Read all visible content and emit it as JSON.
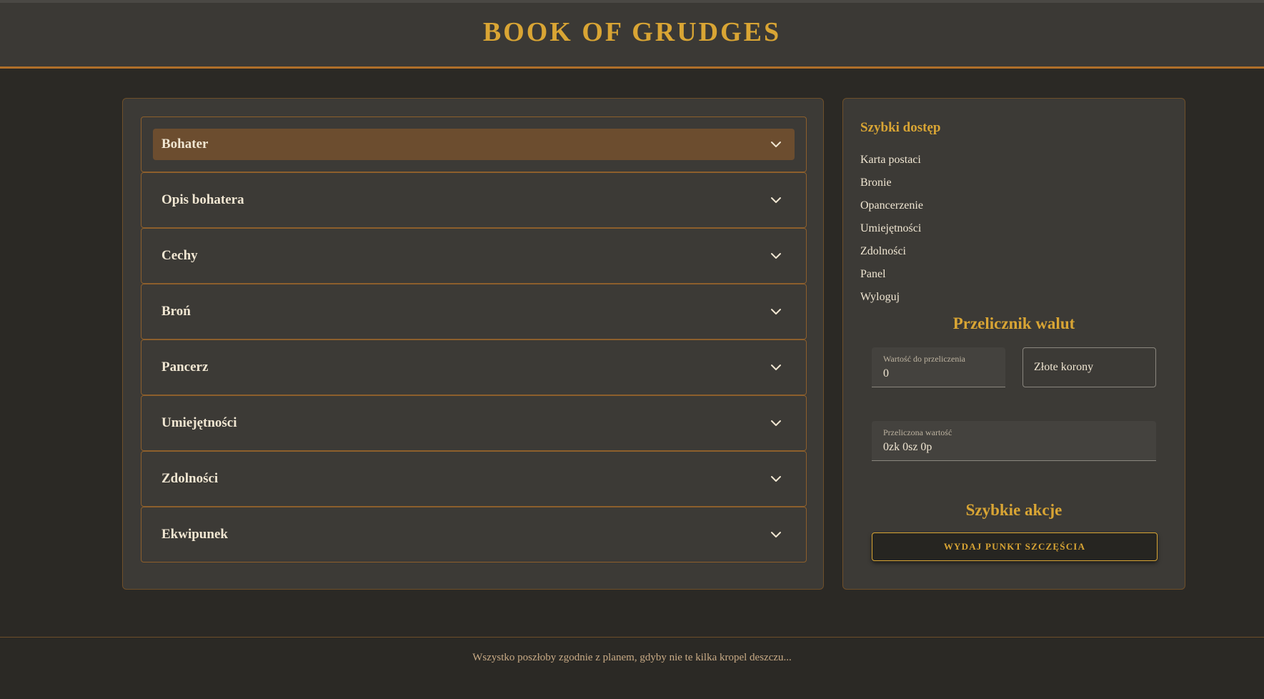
{
  "header": {
    "title": "BOOK OF GRUDGES"
  },
  "accordion": [
    {
      "label": "Bohater",
      "active": true
    },
    {
      "label": "Opis bohatera",
      "active": false
    },
    {
      "label": "Cechy",
      "active": false
    },
    {
      "label": "Broń",
      "active": false
    },
    {
      "label": "Pancerz",
      "active": false
    },
    {
      "label": "Umiejętności",
      "active": false
    },
    {
      "label": "Zdolności",
      "active": false
    },
    {
      "label": "Ekwipunek",
      "active": false
    }
  ],
  "sidebar": {
    "quick_access_title": "Szybki dostęp",
    "links": [
      "Karta postaci",
      "Bronie",
      "Opancerzenie",
      "Umiejętności",
      "Zdolności",
      "Panel",
      "Wyloguj"
    ],
    "converter": {
      "title": "Przelicznik walut",
      "amount_label": "Wartość do przeliczenia",
      "amount_value": "0",
      "currency_selected": "Złote korony",
      "result_label": "Przeliczona wartość",
      "result_value": "0zk 0sz 0p"
    },
    "actions": {
      "title": "Szybkie akcje",
      "luck_button": "WYDAJ PUNKT SZCZĘŚCIA"
    }
  },
  "footer": {
    "text": "Wszystko poszłoby zgodnie z planem, gdyby nie te kilka kropel deszczu..."
  },
  "colors": {
    "background": "#2b2925",
    "panel": "#3c3a36",
    "accent_gold": "#d9a534",
    "accent_bronze": "#b06f2a",
    "active_item": "#6c4d2f"
  },
  "icons": {
    "accordion_toggle": "chevron-down-icon"
  }
}
